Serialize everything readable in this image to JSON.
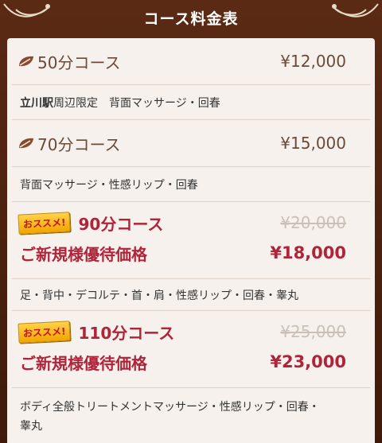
{
  "header": {
    "title": "コース料金表"
  },
  "courses": [
    {
      "name": "50分コース",
      "price": "¥12,000",
      "desc_highlight": "立川駅",
      "desc": "周辺限定　背面マッサージ・回春"
    },
    {
      "name": "70分コース",
      "price": "¥15,000",
      "desc": "背面マッサージ・性感リップ・回春"
    }
  ],
  "promos": [
    {
      "badge": "おススメ!",
      "name": "90分コース",
      "old_price": "¥20,000",
      "label": "ご新規様優待価格",
      "price": "¥18,000",
      "desc": "足・背中・デコルテ・首・肩・性感リップ・回春・睾丸"
    },
    {
      "badge": "おススメ!",
      "name": "110分コース",
      "old_price": "¥25,000",
      "label": "ご新規様優待価格",
      "price": "¥23,000",
      "desc_line1": "ボディ全般トリートメントマッサージ・性感リップ・回春・",
      "desc_line2": "睾丸"
    }
  ],
  "colors": {
    "frame": "#4a2110",
    "panel": "#f6f1ec",
    "accent": "#b0243a",
    "text": "#6b4a3a"
  },
  "icons": {
    "leaf": "leaf-icon",
    "ornament": "ornament-flourish"
  }
}
